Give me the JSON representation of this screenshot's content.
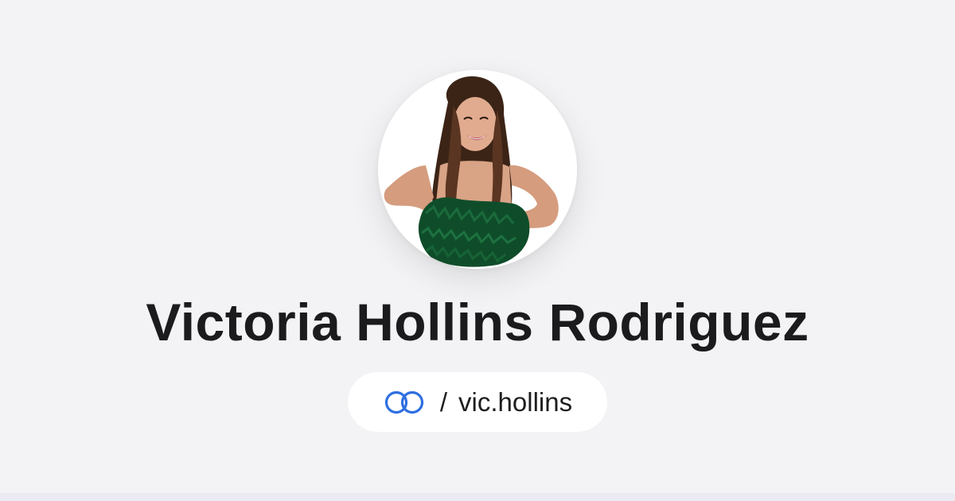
{
  "profile": {
    "name": "Victoria Hollins Rodriguez",
    "handle_separator": "/",
    "handle": "vic.hollins",
    "avatar_alt": "profile photo"
  },
  "icons": {
    "link": "linked-circles-icon"
  },
  "colors": {
    "background": "#f3f3f5",
    "name_text": "#1b1b1d",
    "pill_background": "#ffffff",
    "icon_blue": "#2f6fe0"
  }
}
